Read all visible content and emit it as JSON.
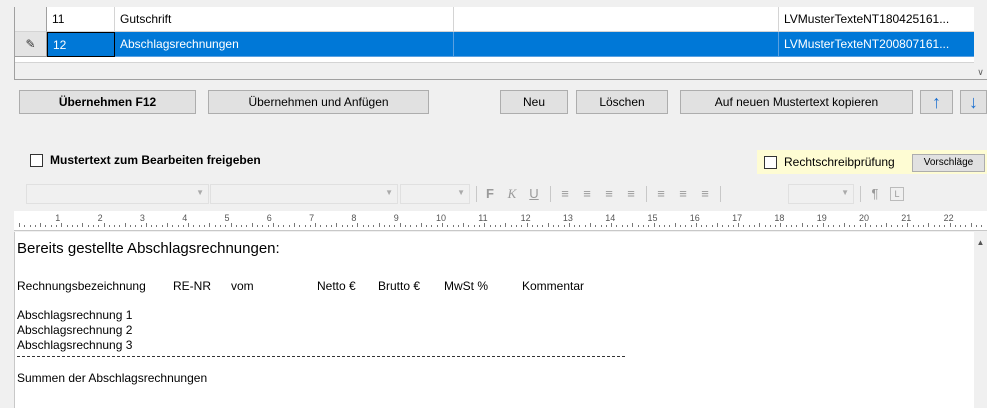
{
  "grid": {
    "rows": [
      {
        "indicator": "",
        "nr": "11",
        "name": "Gutschrift",
        "extra": "",
        "file": "LVMusterTexteNT180425161..."
      },
      {
        "indicator": "✎",
        "nr": "12",
        "name": "Abschlagsrechnungen",
        "extra": "",
        "file": "LVMusterTexteNT200807161..."
      }
    ],
    "scroll_down_icon": "chevron-down-icon"
  },
  "buttons": {
    "uebernehmen": "Übernehmen F12",
    "uebernehmen_anfuegen": "Übernehmen und Anfügen",
    "neu": "Neu",
    "loeschen": "Löschen",
    "kopieren": "Auf neuen Mustertext kopieren",
    "up_icon": "arrow-up-icon",
    "down_icon": "arrow-down-icon"
  },
  "checkboxes": {
    "freigeben": {
      "label": "Mustertext zum Bearbeiten freigeben",
      "checked": false
    },
    "rechtschreib": {
      "label": "Rechtschreibprüfung",
      "checked": false
    },
    "vorschlaege_label": "Vorschläge"
  },
  "toolbar": {
    "font_name": "",
    "font_style": "",
    "font_size": "",
    "bold": "F",
    "italic": "K",
    "underline": "U",
    "zoom": "",
    "pilcrow": "¶",
    "icons": [
      "align-left-icon",
      "align-center-icon",
      "align-right-icon",
      "justify-icon",
      "bullet-list-icon",
      "numbered-list-icon",
      "outline-list-icon",
      "pilcrow-icon",
      "tab-icon"
    ]
  },
  "ruler": {
    "labels": [
      "1",
      "2",
      "3",
      "4",
      "5",
      "6",
      "7",
      "8",
      "9",
      "10",
      "11",
      "12",
      "13",
      "14",
      "15",
      "16",
      "17",
      "18",
      "19",
      "20",
      "21",
      "22"
    ]
  },
  "document": {
    "heading": "Bereits gestellte Abschlagsrechnungen:",
    "columns": [
      "Rechnungsbezeichnung",
      "RE-NR",
      "vom",
      "Netto €",
      "Brutto €",
      "MwSt %",
      "Kommentar"
    ],
    "items": [
      "Abschlagsrechnung 1",
      "Abschlagsrechnung 2",
      "Abschlagsrechnung 3"
    ],
    "footer": "Summen der Abschlagsrechnungen"
  },
  "colors": {
    "selection": "#0078d7",
    "arrow": "#1a6fd0",
    "spell_bg": "#fefcd3"
  }
}
